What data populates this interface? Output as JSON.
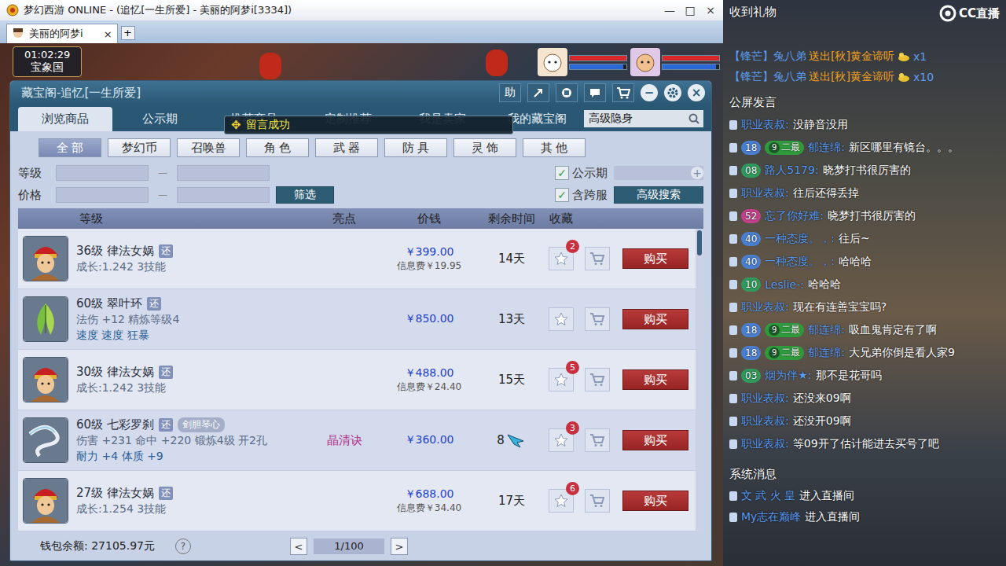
{
  "window": {
    "title": "梦幻西游 ONLINE - (追忆[一生所爱] - 美丽的阿梦i[3334])",
    "controls": [
      "—",
      "□",
      "×"
    ]
  },
  "client_tabs": [
    {
      "label": "美丽的阿梦i",
      "selected": true,
      "close": "×"
    }
  ],
  "new_tab": "+",
  "hud": {
    "time": "01:02:29",
    "location": "宝象国",
    "party": [
      {
        "kind": "pet",
        "hp": 1.0,
        "mp": 0.95
      },
      {
        "kind": "player",
        "hp": 1.0,
        "mp": 0.95
      }
    ]
  },
  "treasure": {
    "title": "藏宝阁-追忆[一生所爱]",
    "help": "助",
    "minimize": "−",
    "close": "×",
    "tabs": [
      {
        "label": "浏览商品",
        "selected": true
      },
      {
        "label": "公示期",
        "selected": false
      },
      {
        "label": "推荐商品",
        "selected": false
      },
      {
        "label": "定制推荐",
        "selected": false
      },
      {
        "label": "我是卖家",
        "selected": false
      },
      {
        "label": "我的藏宝阁",
        "selected": false
      }
    ],
    "search": {
      "value": "高级隐身"
    },
    "toast": {
      "icon": "✥",
      "text": "留言成功"
    },
    "categories": [
      {
        "label": "全 部",
        "selected": true
      },
      {
        "label": "梦幻币",
        "selected": false
      },
      {
        "label": "召唤兽",
        "selected": false
      },
      {
        "label": "角 色",
        "selected": false
      },
      {
        "label": "武 器",
        "selected": false
      },
      {
        "label": "防 具",
        "selected": false
      },
      {
        "label": "灵 饰",
        "selected": false
      },
      {
        "label": "其 他",
        "selected": false
      }
    ],
    "filters": {
      "level_label": "等级",
      "price_label": "价格",
      "dash": "—",
      "filter_button": "筛选",
      "public": {
        "label": "公示期",
        "checked": true
      },
      "cross": {
        "label": "含跨服",
        "checked": true
      },
      "add": "+",
      "advanced": "高级搜索"
    },
    "columns": [
      "等级",
      "亮点",
      "价钱",
      "剩余时间",
      "收藏"
    ],
    "rows": [
      {
        "kind": "pet",
        "name": "36级 律法女娲",
        "tag": "还",
        "special": "",
        "lines": [
          {
            "text": "成长:1.242 3技能",
            "color": "#5b6c86"
          }
        ],
        "highlight": "",
        "price": "￥399.00",
        "fee": "信息费￥19.95",
        "time": "14天",
        "fav": "2",
        "buy": "购买"
      },
      {
        "kind": "ring",
        "name": "60级 翠叶环",
        "tag": "还",
        "special": "",
        "lines": [
          {
            "text": "法伤 +12 精炼等级4",
            "color": "#5b6c86"
          },
          {
            "text": "速度 速度 狂暴",
            "color": "#2a5f98"
          }
        ],
        "highlight": "",
        "price": "￥850.00",
        "fee": "",
        "time": "13天",
        "fav": "",
        "buy": "购买"
      },
      {
        "kind": "pet",
        "name": "30级 律法女娲",
        "tag": "还",
        "special": "",
        "lines": [
          {
            "text": "成长:1.242 3技能",
            "color": "#5b6c86"
          }
        ],
        "highlight": "",
        "price": "￥488.00",
        "fee": "信息费￥24.40",
        "time": "15天",
        "fav": "5",
        "buy": "购买"
      },
      {
        "kind": "sash",
        "name": "60级 七彩罗刹",
        "tag": "还",
        "special": "剑胆琴心",
        "lines": [
          {
            "text": "伤害 +231 命中 +220 锻炼4级 开2孔",
            "color": "#5b6c86"
          },
          {
            "text": "耐力 +4 体质 +9",
            "color": "#2a5f98"
          }
        ],
        "highlight": "晶清诀",
        "price": "￥360.00",
        "fee": "",
        "time": "8",
        "fav": "3",
        "buy": "购买"
      },
      {
        "kind": "pet",
        "name": "27级 律法女娲",
        "tag": "还",
        "special": "",
        "lines": [
          {
            "text": "成长:1.254 3技能",
            "color": "#5b6c86"
          }
        ],
        "highlight": "",
        "price": "￥688.00",
        "fee": "信息费￥34.40",
        "time": "17天",
        "fav": "6",
        "buy": "购买"
      }
    ],
    "footer": {
      "wallet": "钱包余额: 27105.97元",
      "help": "?",
      "prev": "<",
      "page": "1/100",
      "next": ">"
    }
  },
  "stream": {
    "logo": "CC直播",
    "gifts_title": "收到礼物",
    "gifts": [
      {
        "badge": "【锋芒】",
        "user": "兔八弟",
        "action": "送出[秋]黄金谛听",
        "count": "x1"
      },
      {
        "badge": "【锋芒】",
        "user": "兔八弟",
        "action": "送出[秋]黄金谛听",
        "count": "x10"
      }
    ],
    "chat_title": "公屏发言",
    "chat": [
      {
        "badges": [],
        "user": "职业表叔:",
        "text": "没静音没用"
      },
      {
        "badges": [
          {
            "kind": "level",
            "text": "18",
            "color": "#4a7fd0"
          },
          {
            "kind": "rank",
            "icon": "9",
            "text": "二最",
            "color": "#2f9a3c"
          }
        ],
        "user": "郁连绵:",
        "text": "新区哪里有镜台。。。"
      },
      {
        "badges": [
          {
            "kind": "level",
            "text": "08",
            "color": "#2f9a5c"
          }
        ],
        "user": "路人5179:",
        "text": "晓梦打书很厉害的"
      },
      {
        "badges": [],
        "user": "职业表叔:",
        "text": "往后还得丢掉"
      },
      {
        "badges": [
          {
            "kind": "level",
            "text": "52",
            "color": "#c0408a"
          }
        ],
        "user": "忘了你好难:",
        "text": "晓梦打书很厉害的"
      },
      {
        "badges": [
          {
            "kind": "level",
            "text": "40",
            "color": "#4a7fd0"
          }
        ],
        "user": "一种态度。，:",
        "text": "往后~"
      },
      {
        "badges": [
          {
            "kind": "level",
            "text": "40",
            "color": "#4a7fd0"
          }
        ],
        "user": "一种态度。，:",
        "text": "哈哈哈"
      },
      {
        "badges": [
          {
            "kind": "level",
            "text": "10",
            "color": "#2f9a5c"
          }
        ],
        "user": "Leslie-:",
        "text": "哈哈哈"
      },
      {
        "badges": [],
        "user": "职业表叔:",
        "text": "现在有连善宝宝吗?"
      },
      {
        "badges": [
          {
            "kind": "level",
            "text": "18",
            "color": "#4a7fd0"
          },
          {
            "kind": "rank",
            "icon": "9",
            "text": "二最",
            "color": "#2f9a3c"
          }
        ],
        "user": "郁连绵:",
        "text": "吸血鬼肯定有了啊"
      },
      {
        "badges": [
          {
            "kind": "level",
            "text": "18",
            "color": "#4a7fd0"
          },
          {
            "kind": "rank",
            "icon": "9",
            "text": "二最",
            "color": "#2f9a3c"
          }
        ],
        "user": "郁连绵:",
        "text": "大兄弟你倒是看人家9"
      },
      {
        "badges": [
          {
            "kind": "level",
            "text": "03",
            "color": "#2f9a5c"
          }
        ],
        "user": "烟为伴★:",
        "text": "那不是花哥吗"
      },
      {
        "badges": [],
        "user": "职业表叔:",
        "text": "还没来09啊"
      },
      {
        "badges": [],
        "user": "职业表叔:",
        "text": "还没开09啊"
      },
      {
        "badges": [],
        "user": "职业表叔:",
        "text": "等09开了估计能进去买号了吧"
      }
    ],
    "system_title": "系统消息",
    "system": [
      {
        "user": "文 武 火 皇",
        "text": "进入直播间"
      },
      {
        "user": "My志在巅峰",
        "text": "进入直播间"
      }
    ]
  }
}
